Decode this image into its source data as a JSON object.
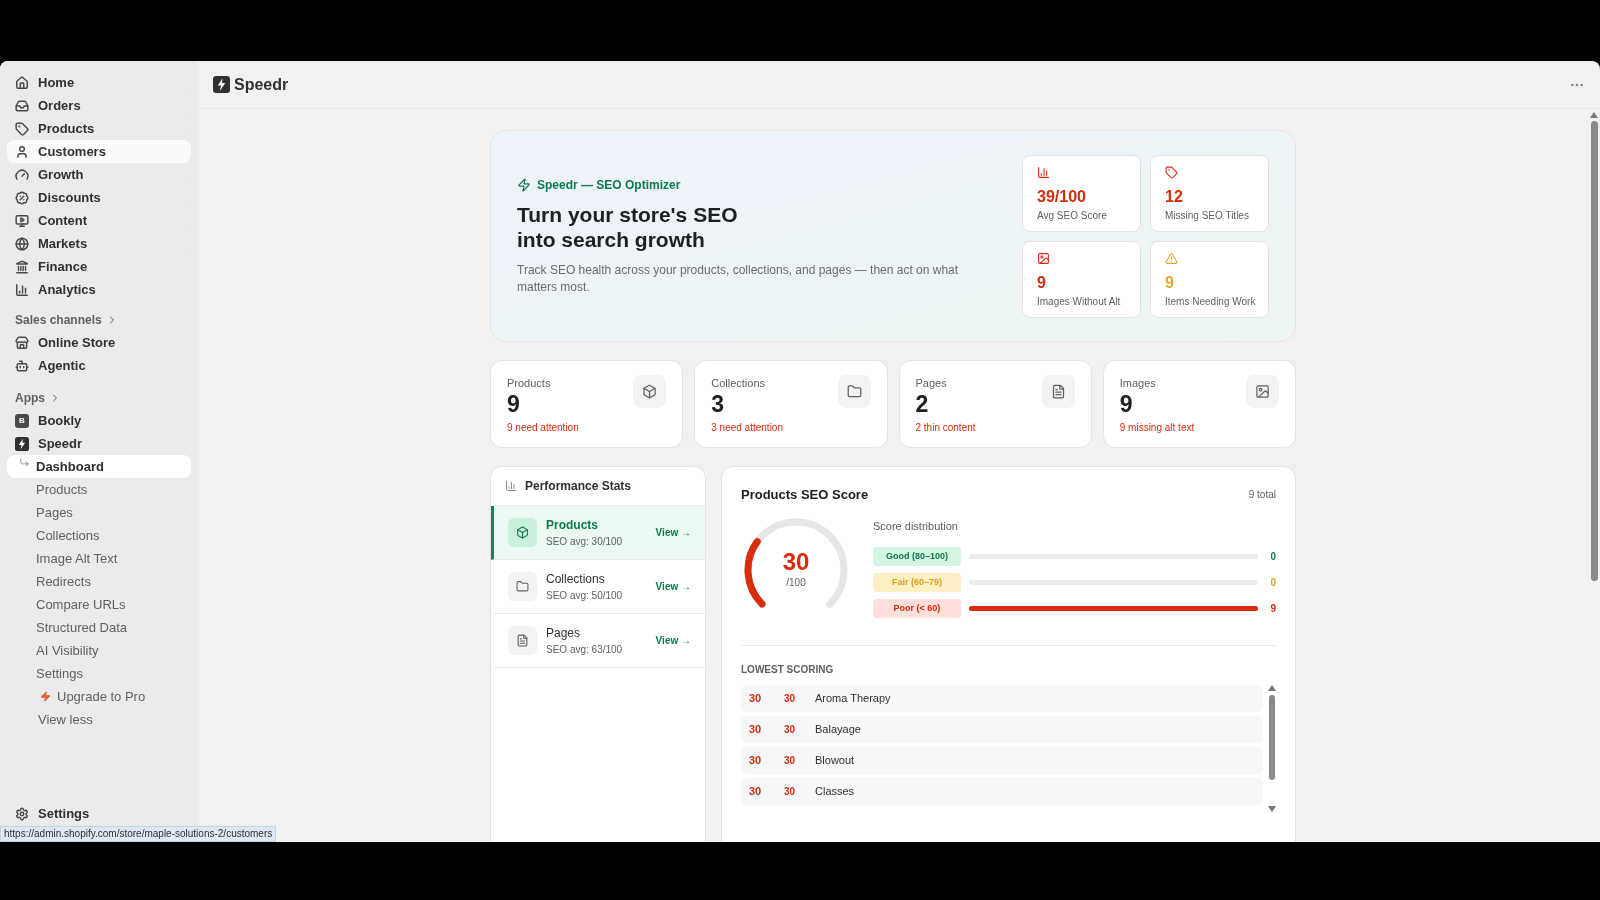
{
  "sidebar": {
    "main_items": [
      {
        "label": "Home",
        "hovered": false
      },
      {
        "label": "Orders",
        "hovered": false
      },
      {
        "label": "Products",
        "hovered": false
      },
      {
        "label": "Customers",
        "hovered": true
      },
      {
        "label": "Growth",
        "hovered": false
      },
      {
        "label": "Discounts",
        "hovered": false
      },
      {
        "label": "Content",
        "hovered": false
      },
      {
        "label": "Markets",
        "hovered": false
      },
      {
        "label": "Finance",
        "hovered": false
      },
      {
        "label": "Analytics",
        "hovered": false
      }
    ],
    "sales_channels": {
      "title": "Sales channels",
      "items": [
        {
          "label": "Online Store"
        },
        {
          "label": "Agentic"
        }
      ]
    },
    "apps": {
      "title": "Apps",
      "items": [
        {
          "label": "Bookly",
          "badge": "B"
        },
        {
          "label": "Speedr"
        }
      ]
    },
    "app_subitems": [
      {
        "label": "Dashboard",
        "selected": true
      },
      {
        "label": "Products",
        "selected": false
      },
      {
        "label": "Pages",
        "selected": false
      },
      {
        "label": "Collections",
        "selected": false
      },
      {
        "label": "Image Alt Text",
        "selected": false
      },
      {
        "label": "Redirects",
        "selected": false
      },
      {
        "label": "Compare URLs",
        "selected": false
      },
      {
        "label": "Structured Data",
        "selected": false
      },
      {
        "label": "AI Visibility",
        "selected": false
      },
      {
        "label": "Settings",
        "selected": false
      }
    ],
    "upgrade": "Upgrade to Pro",
    "view_less": "View less",
    "settings": "Settings"
  },
  "status_url": "https://admin.shopify.com/store/maple-solutions-2/customers",
  "header": {
    "app_name": "Speedr"
  },
  "hero": {
    "eyebrow": "Speedr — SEO Optimizer",
    "title_lines": [
      "Turn your store's SEO",
      "into search growth"
    ],
    "description": "Track SEO health across your products, collections, and pages — then act on what matters most.",
    "metrics": [
      {
        "value": "39/100",
        "label": "Avg SEO Score",
        "color": "#d82c0d"
      },
      {
        "value": "12",
        "label": "Missing SEO Titles",
        "color": "#d82c0d"
      },
      {
        "value": "9",
        "label": "Images Without Alt",
        "color": "#d82c0d"
      },
      {
        "value": "9",
        "label": "Items Needing Work",
        "color": "#e0a82e"
      }
    ]
  },
  "stat_cards": [
    {
      "label": "Products",
      "value": "9",
      "note": "9 need attention"
    },
    {
      "label": "Collections",
      "value": "3",
      "note": "3 need attention"
    },
    {
      "label": "Pages",
      "value": "2",
      "note": "2 thin content"
    },
    {
      "label": "Images",
      "value": "9",
      "note": "9 missing alt text"
    }
  ],
  "performance": {
    "title": "Performance Stats",
    "items": [
      {
        "name": "Products",
        "avg": "SEO avg: 30/100",
        "link": "View →",
        "selected": true
      },
      {
        "name": "Collections",
        "avg": "SEO avg: 50/100",
        "link": "View →",
        "selected": false
      },
      {
        "name": "Pages",
        "avg": "SEO avg: 63/100",
        "link": "View →",
        "selected": false
      }
    ]
  },
  "score": {
    "title": "Products SEO Score",
    "total": "9 total",
    "gauge": {
      "value": "30",
      "suffix": "/100",
      "level": 0.3
    },
    "distribution_title": "Score distribution",
    "bands": [
      {
        "kind": "good",
        "label": "Good (80–100)",
        "count": "0",
        "level": 0
      },
      {
        "kind": "fair",
        "label": "Fair (60–79)",
        "count": "0",
        "level": 0
      },
      {
        "kind": "poor",
        "label": "Poor (< 60)",
        "count": "9",
        "level": 1
      }
    ],
    "lowest_title": "LOWEST SCORING",
    "rows": [
      {
        "score": "30",
        "column_2": "30",
        "name": "Aroma Therapy"
      },
      {
        "score": "30",
        "column_2": "30",
        "name": "Balayage"
      },
      {
        "score": "30",
        "column_2": "30",
        "name": "Blowout"
      },
      {
        "score": "30",
        "column_2": "30",
        "name": "Classes"
      }
    ]
  }
}
